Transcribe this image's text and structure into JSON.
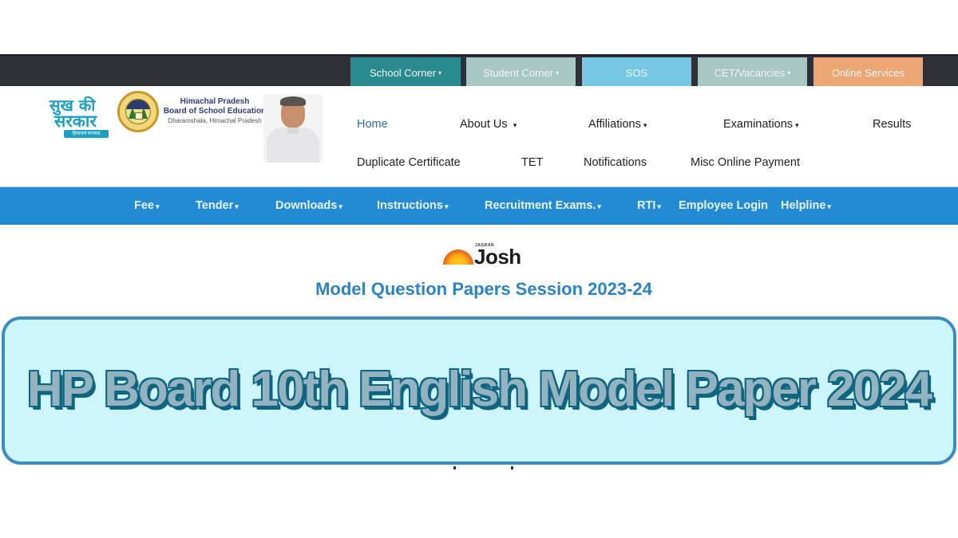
{
  "topbar": {
    "items": [
      {
        "label": "School Corner",
        "has_dropdown": true,
        "color": "#2a8a8e"
      },
      {
        "label": "Student Corner",
        "has_dropdown": true,
        "color": "#a7c6c4"
      },
      {
        "label": "SOS",
        "has_dropdown": false,
        "color": "#76c7e3"
      },
      {
        "label": "CET/Vacancies",
        "has_dropdown": true,
        "color": "#a7c6c4"
      },
      {
        "label": "Online Services",
        "has_dropdown": false,
        "color": "#eca672"
      }
    ],
    "caret": "▾"
  },
  "header": {
    "slogan": {
      "line1": "सुख की",
      "line2": "सरकार",
      "line3": "हिमाचल सरकार"
    },
    "board": {
      "line1": "Himachal Pradesh",
      "line2": "Board of School Education",
      "line3": "Dharamshala, Himachal Pradesh"
    },
    "nav_row1": [
      {
        "label": "Home",
        "has_dropdown": false
      },
      {
        "label": "About Us",
        "has_dropdown": true
      },
      {
        "label": "Affiliations",
        "has_dropdown": true
      },
      {
        "label": "Examinations",
        "has_dropdown": true
      },
      {
        "label": "Results",
        "has_dropdown": false
      }
    ],
    "nav_row2": [
      {
        "label": "Duplicate Certificate"
      },
      {
        "label": "TET"
      },
      {
        "label": "Notifications"
      },
      {
        "label": "Misc Online Payment"
      }
    ]
  },
  "menubar": {
    "items": [
      {
        "label": "Fee",
        "has_dropdown": true
      },
      {
        "label": "Tender",
        "has_dropdown": true
      },
      {
        "label": "Downloads",
        "has_dropdown": true
      },
      {
        "label": "Instructions",
        "has_dropdown": true
      },
      {
        "label": "Recruitment Exams.",
        "has_dropdown": true
      },
      {
        "label": "RTI",
        "has_dropdown": true
      },
      {
        "label": "Employee Login",
        "has_dropdown": false
      },
      {
        "label": "Helpline",
        "has_dropdown": true
      }
    ]
  },
  "watermark": {
    "small": "JAGRAN",
    "word": "Josh"
  },
  "content": {
    "subtitle": "Model Question Papers Session 2023-24"
  },
  "banner": {
    "title": "HP Board  10th English Model Paper 2024"
  },
  "colors": {
    "topbar_bg": "#2f3038",
    "menubar_bg": "#238bd3",
    "subtitle": "#2b83c2",
    "banner_bg": "#cdf5fc",
    "banner_border": "#3d8cbf",
    "banner_text_fill": "#93b3c0",
    "banner_text_outline": "#0f6580",
    "home_link": "#2a6f9b"
  }
}
